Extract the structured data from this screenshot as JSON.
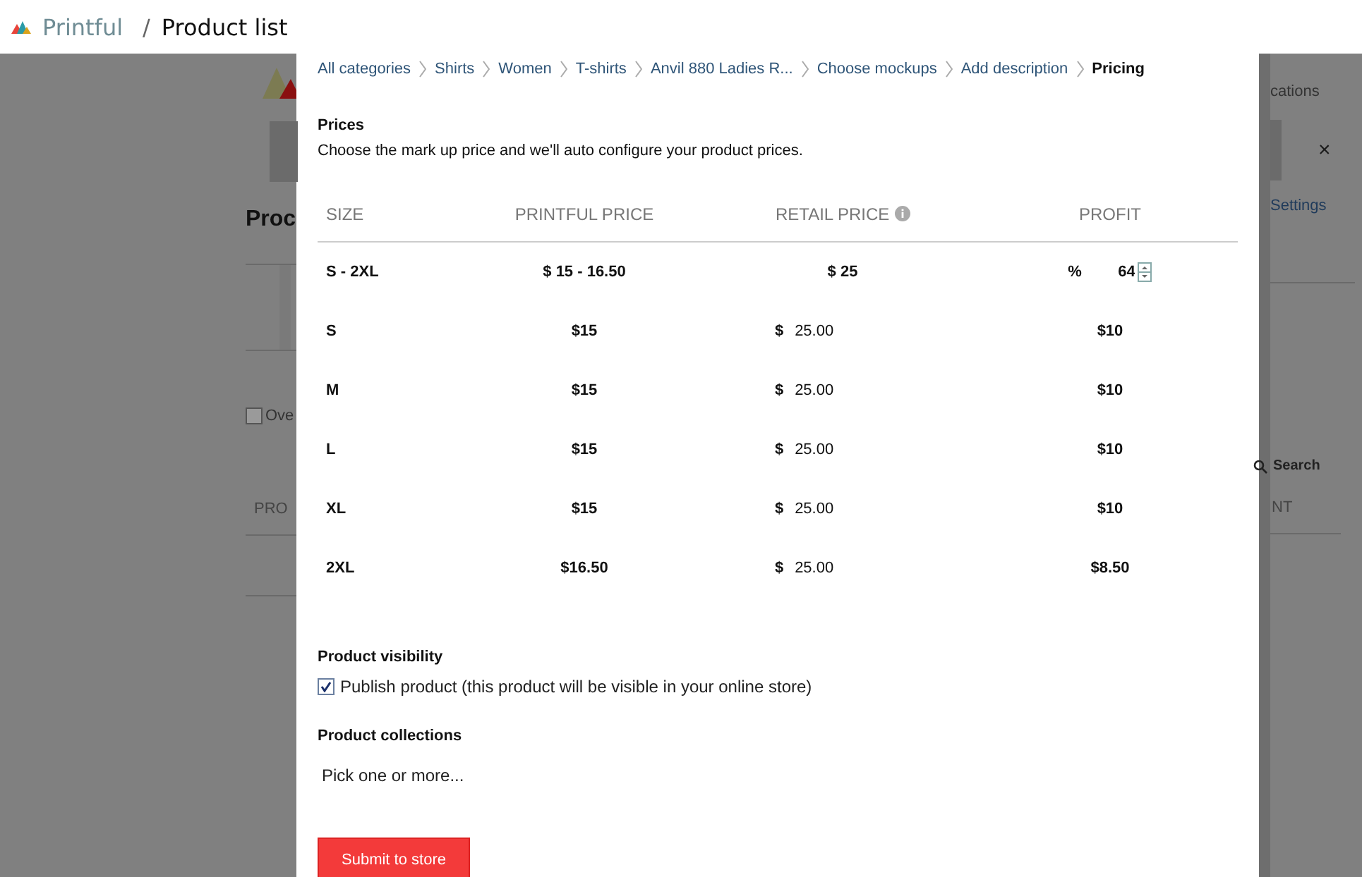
{
  "header": {
    "brand": "Printful",
    "separator": "/",
    "page_title": "Product list"
  },
  "background_page": {
    "heading": "Proc",
    "checkbox": {
      "label": "Ove",
      "checked": false
    },
    "column_left": "PRO",
    "tab_text": "cations",
    "close": "×",
    "settings_link": "Settings",
    "search_button": "Search",
    "column_right": "NT"
  },
  "dialog": {
    "breadcrumbs": [
      {
        "label": "All categories",
        "current": false
      },
      {
        "label": "Shirts",
        "current": false
      },
      {
        "label": "Women",
        "current": false
      },
      {
        "label": "T-shirts",
        "current": false
      },
      {
        "label": "Anvil 880 Ladies R...",
        "current": false
      },
      {
        "label": "Choose mockups",
        "current": false
      },
      {
        "label": "Add description",
        "current": false
      },
      {
        "label": "Pricing",
        "current": true
      }
    ],
    "prices_title": "Prices",
    "prices_hint": "Choose the mark up price and we'll auto configure your product prices.",
    "table": {
      "columns": [
        "SIZE",
        "PRINTFUL PRICE",
        "RETAIL PRICE",
        "PROFIT"
      ],
      "summary_row": {
        "size": "S - 2XL",
        "printful_price": "$ 15 - 16.50",
        "retail_price": "$ 25",
        "profit_unit": "%",
        "profit_value": "64"
      },
      "rows": [
        {
          "size": "S",
          "printful_price": "$15",
          "currency": "$",
          "retail_price": "25.00",
          "profit": "$10"
        },
        {
          "size": "M",
          "printful_price": "$15",
          "currency": "$",
          "retail_price": "25.00",
          "profit": "$10"
        },
        {
          "size": "L",
          "printful_price": "$15",
          "currency": "$",
          "retail_price": "25.00",
          "profit": "$10"
        },
        {
          "size": "XL",
          "printful_price": "$15",
          "currency": "$",
          "retail_price": "25.00",
          "profit": "$10"
        },
        {
          "size": "2XL",
          "printful_price": "$16.50",
          "currency": "$",
          "retail_price": "25.00",
          "profit": "$8.50"
        }
      ]
    },
    "visibility": {
      "title": "Product visibility",
      "checkbox": {
        "label": "Publish product (this product will be visible in your online store)",
        "checked": true
      }
    },
    "collections": {
      "title": "Product collections",
      "placeholder": "Pick one or more..."
    },
    "submit": "Submit to store"
  }
}
